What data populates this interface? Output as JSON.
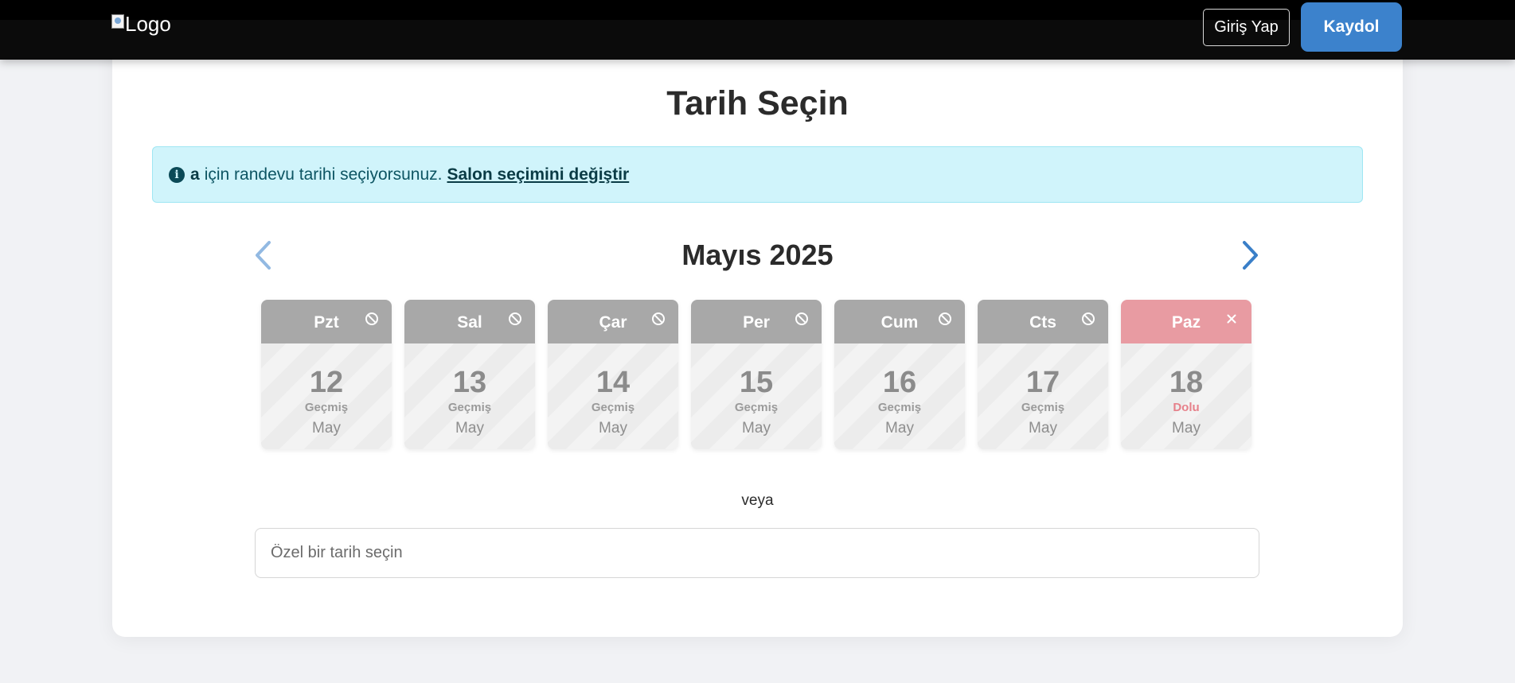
{
  "header": {
    "logo_alt": "Logo",
    "login_label": "Giriş Yap",
    "signup_label": "Kaydol",
    "colors": {
      "bar": "#0b0b0b",
      "signup": "#3c82cc"
    }
  },
  "main": {
    "title": "Tarih Seçin",
    "alert": {
      "icon": "info-circle-icon",
      "salon_name": "a",
      "message": "için randevu tarihi seçiyorsunuz.",
      "change_link": "Salon seçimini değiştir"
    },
    "calendar": {
      "month_label": "Mayıs 2025",
      "prev_icon": "chevron-left-icon",
      "next_icon": "chevron-right-icon",
      "days": [
        {
          "weekday": "Pzt",
          "day": "12",
          "status": "Geçmiş",
          "month": "May",
          "state": "past",
          "icon": "ban-icon"
        },
        {
          "weekday": "Sal",
          "day": "13",
          "status": "Geçmiş",
          "month": "May",
          "state": "past",
          "icon": "ban-icon"
        },
        {
          "weekday": "Çar",
          "day": "14",
          "status": "Geçmiş",
          "month": "May",
          "state": "past",
          "icon": "ban-icon"
        },
        {
          "weekday": "Per",
          "day": "15",
          "status": "Geçmiş",
          "month": "May",
          "state": "past",
          "icon": "ban-icon"
        },
        {
          "weekday": "Cum",
          "day": "16",
          "status": "Geçmiş",
          "month": "May",
          "state": "past",
          "icon": "ban-icon"
        },
        {
          "weekday": "Cts",
          "day": "17",
          "status": "Geçmiş",
          "month": "May",
          "state": "past",
          "icon": "ban-icon"
        },
        {
          "weekday": "Paz",
          "day": "18",
          "status": "Dolu",
          "month": "May",
          "state": "full",
          "icon": "close-icon"
        }
      ],
      "colors": {
        "past_header": "#a8a8a8",
        "full_header": "#e89ba2",
        "full_status": "#e6808a"
      }
    },
    "or_label": "veya",
    "custom_date": {
      "placeholder": "Özel bir tarih seçin",
      "value": ""
    }
  }
}
